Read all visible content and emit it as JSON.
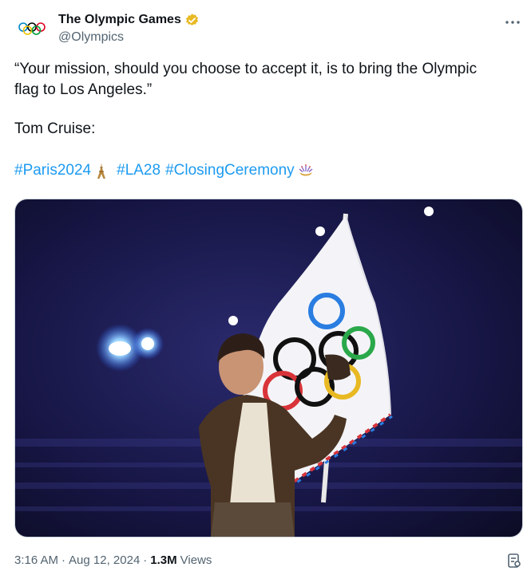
{
  "author": {
    "name": "The Olympic Games",
    "handle": "@Olympics",
    "verified": "gold-check-icon"
  },
  "tweet": {
    "line1": "“Your mission, should you choose to accept it, is to bring the Olympic",
    "line2": "flag to Los Angeles.”",
    "line3": "Tom Cruise:",
    "hashtags": [
      "#Paris2024",
      "#LA28",
      "#ClosingCeremony"
    ]
  },
  "media": {
    "alt": "Tom Cruise carrying the Olympic flag at the Paris 2024 closing ceremony"
  },
  "meta": {
    "time": "3:16 AM",
    "dot1": "·",
    "date": "Aug 12, 2024",
    "dot2": "·",
    "views_count": "1.3M",
    "views_label": "Views"
  },
  "colors": {
    "link": "#1d9bf0",
    "muted": "#536471",
    "verified": "#e8b923"
  }
}
